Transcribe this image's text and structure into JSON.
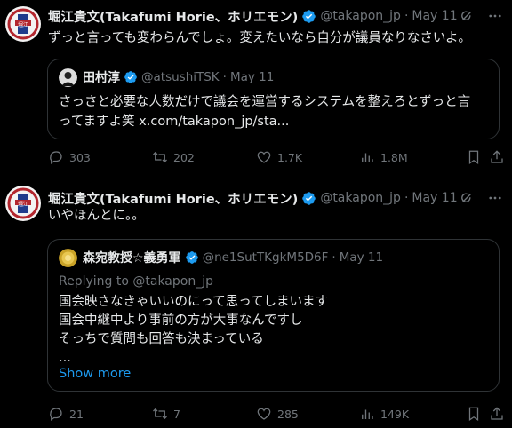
{
  "tweets": [
    {
      "author": {
        "name": "堀江貴文(Takafumi Horie、ホリエモン)",
        "handle": "@takapon_jp",
        "date": "May 11",
        "avatar_text": "堀江"
      },
      "text": "ずっと言っても変わらんでしょ。変えたいなら自分が議員なりなさいよ。",
      "quote": {
        "name": "田村淳",
        "handle": "@atsushiTSK",
        "date": "May 11",
        "lines": [
          "さっさと必要な人数だけで議会を運営するシステムを整えろとずっと言",
          "ってますよ笑 x.com/takapon_jp/sta..."
        ]
      },
      "stats": {
        "replies": "303",
        "retweets": "202",
        "likes": "1.7K",
        "views": "1.8M"
      }
    },
    {
      "author": {
        "name": "堀江貴文(Takafumi Horie、ホリエモン)",
        "handle": "@takapon_jp",
        "date": "May 11",
        "avatar_text": "堀江"
      },
      "text": "いやほんとに。。",
      "quote": {
        "name": "森宛教授☆義勇軍",
        "handle": "@ne1SutTKgkM5D6F",
        "date": "May 11",
        "replying_to": "Replying to @takapon_jp",
        "lines": [
          "国会映さなきゃいいのにって思ってしまいます",
          "国会中継中より事前の方が大事なんですし",
          "そっちで質問も回答も決まっている",
          "..."
        ],
        "show_more": "Show more"
      },
      "stats": {
        "replies": "21",
        "retweets": "7",
        "likes": "285",
        "views": "149K"
      }
    }
  ],
  "colors": {
    "background": "#000000",
    "text": "#e7e9ea",
    "muted": "#71767b",
    "border": "#2f3336",
    "accent": "#1d9bf0"
  },
  "icons": [
    "grok-icon",
    "more-icon",
    "reply-icon",
    "retweet-icon",
    "like-icon",
    "views-icon",
    "bookmark-icon",
    "share-icon",
    "verified-badge-icon"
  ]
}
